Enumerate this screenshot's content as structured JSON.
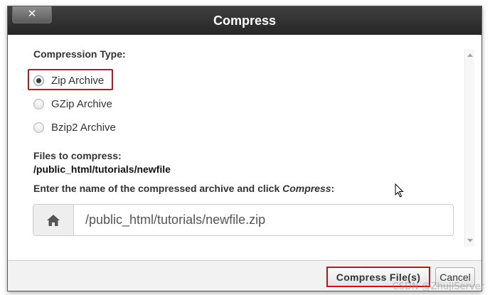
{
  "dialog": {
    "title": "Compress",
    "close_label": "✕"
  },
  "compression": {
    "label": "Compression Type:",
    "options": [
      {
        "label": "Zip Archive",
        "checked": true
      },
      {
        "label": "GZip Archive",
        "checked": false
      },
      {
        "label": "Bzip2 Archive",
        "checked": false
      }
    ]
  },
  "files": {
    "label": "Files to compress:",
    "path": "/public_html/tutorials/newfile"
  },
  "archive": {
    "instruction_prefix": "Enter the name of the compressed archive and click ",
    "instruction_emph": "Compress",
    "instruction_suffix": ":",
    "value": "/public_html/tutorials/newfile.zip",
    "icon": "home-icon"
  },
  "footer": {
    "compress_label": "Compress File(s)",
    "cancel_label": "Cancel"
  },
  "watermark": "CSDN @ZhujiServer",
  "colors": {
    "highlight": "#c0141c",
    "titlebar": "#2e2e2e"
  }
}
